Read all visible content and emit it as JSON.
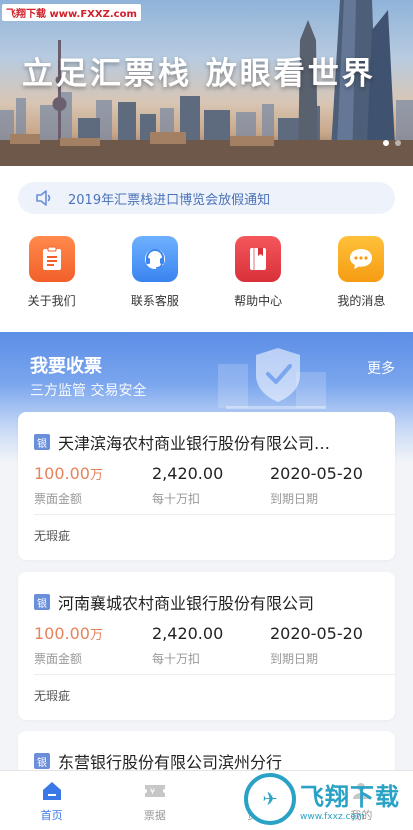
{
  "watermark": {
    "text": "飞翔下载 www.FXXZ.com"
  },
  "banner": {
    "title": "立足汇票栈 放眼看世界",
    "dots": 2
  },
  "notice": {
    "text": "2019年汇票栈进口博览会放假通知"
  },
  "quick_nav": [
    {
      "label": "关于我们",
      "icon": "clipboard-icon"
    },
    {
      "label": "联系客服",
      "icon": "headset-icon"
    },
    {
      "label": "帮助中心",
      "icon": "book-icon"
    },
    {
      "label": "我的消息",
      "icon": "chat-bubble-icon"
    }
  ],
  "collect": {
    "title": "我要收票",
    "subtitle": "三方监管 交易安全",
    "more": "更多"
  },
  "cards": [
    {
      "badge": "银",
      "bank": "天津滨海农村商业银行股份有限公司…",
      "amount": "100.00",
      "amount_unit": "万",
      "amount_label": "票面金额",
      "discount": "2,420.00",
      "discount_label": "每十万扣",
      "due": "2020-05-20",
      "due_label": "到期日期",
      "flaw": "无瑕疵"
    },
    {
      "badge": "银",
      "bank": "河南襄城农村商业银行股份有限公司",
      "amount": "100.00",
      "amount_unit": "万",
      "amount_label": "票面金额",
      "discount": "2,420.00",
      "discount_label": "每十万扣",
      "due": "2020-05-20",
      "due_label": "到期日期",
      "flaw": "无瑕疵"
    },
    {
      "badge": "银",
      "bank": "东营银行股份有限公司滨州分行"
    }
  ],
  "tabs": [
    {
      "label": "首页",
      "active": true
    },
    {
      "label": "票据",
      "active": false
    },
    {
      "label": "资讯",
      "active": false
    },
    {
      "label": "我的",
      "active": false
    }
  ],
  "corner_watermark": {
    "main": "飞翔下载",
    "sub": "www.fxxz.com"
  },
  "colors": {
    "accent": "#3b78e7",
    "amount": "#e8825c",
    "header_blue": "#5b8ee6"
  }
}
